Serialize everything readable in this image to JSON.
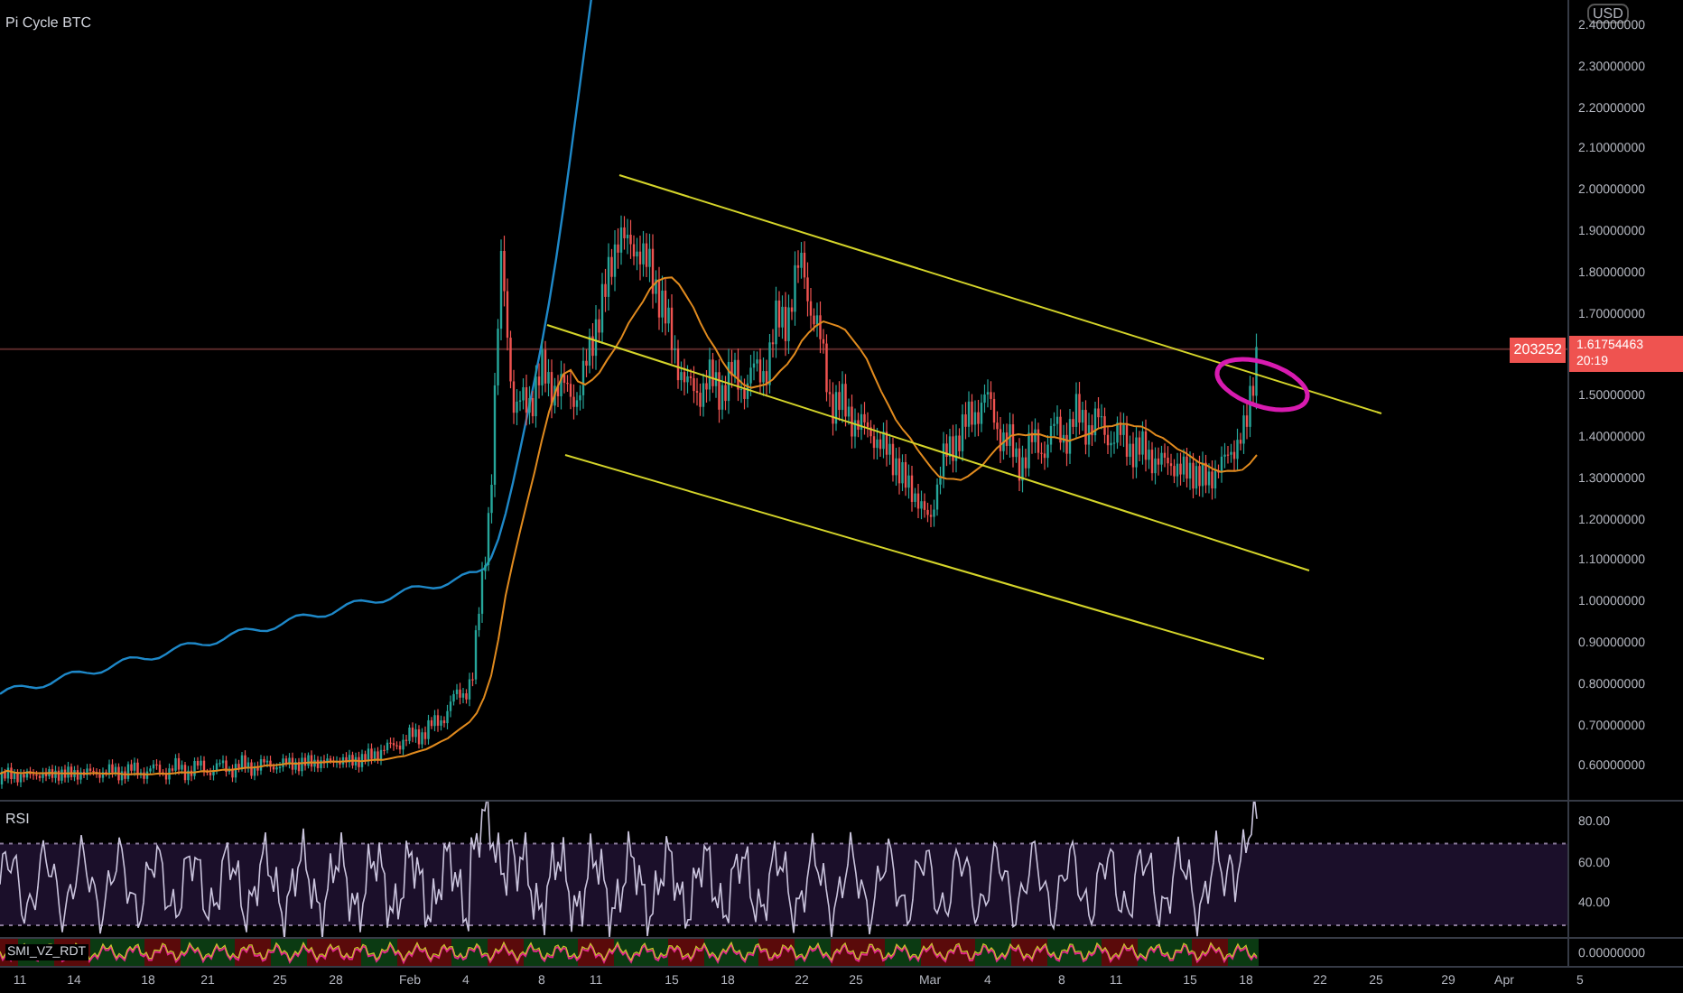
{
  "title": "Pi Cycle BTC",
  "currency": "USD",
  "price_ticks": [
    "2.40000000",
    "2.30000000",
    "2.20000000",
    "2.10000000",
    "2.00000000",
    "1.90000000",
    "1.80000000",
    "1.70000000",
    "1.50000000",
    "1.40000000",
    "1.30000000",
    "1.20000000",
    "1.10000000",
    "1.00000000",
    "0.90000000",
    "0.80000000",
    "0.70000000",
    "0.60000000"
  ],
  "last_price": {
    "value": "1.61754463",
    "countdown": "20:19",
    "tag": "203252"
  },
  "rsi": {
    "label": "RSI",
    "ticks": [
      "80.00",
      "60.00",
      "40.00"
    ]
  },
  "smi": {
    "label": "SMI_VZ_RDT",
    "ticks": [
      "0.00000000"
    ]
  },
  "time_ticks": [
    "11",
    "14",
    "18",
    "21",
    "25",
    "28",
    "Feb",
    "4",
    "8",
    "11",
    "15",
    "18",
    "22",
    "25",
    "Mar",
    "4",
    "8",
    "11",
    "15",
    "18",
    "22",
    "25",
    "29",
    "Apr",
    "5"
  ]
}
